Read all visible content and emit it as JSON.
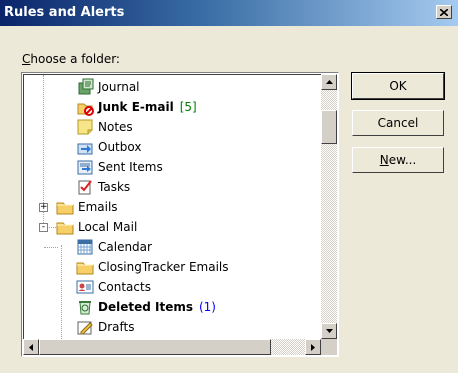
{
  "window": {
    "title": "Rules and Alerts"
  },
  "dialog": {
    "choose_label_accel": "C",
    "choose_label_rest": "hoose a folder:"
  },
  "tree": {
    "items": [
      {
        "label": "Journal",
        "icon": "journal-icon",
        "bold": false,
        "count": ""
      },
      {
        "label": "Junk E-mail",
        "icon": "junk-email-icon",
        "bold": true,
        "count": "[5]"
      },
      {
        "label": "Notes",
        "icon": "notes-icon",
        "bold": false,
        "count": ""
      },
      {
        "label": "Outbox",
        "icon": "outbox-icon",
        "bold": false,
        "count": ""
      },
      {
        "label": "Sent Items",
        "icon": "sent-items-icon",
        "bold": false,
        "count": ""
      },
      {
        "label": "Tasks",
        "icon": "tasks-icon",
        "bold": false,
        "count": ""
      },
      {
        "label": "Emails",
        "icon": "folder-icon",
        "bold": false,
        "count": "",
        "expander": "+"
      },
      {
        "label": "Local Mail",
        "icon": "folder-icon",
        "bold": false,
        "count": "",
        "expander": "-"
      },
      {
        "label": "Calendar",
        "icon": "calendar-icon",
        "bold": false,
        "count": ""
      },
      {
        "label": "ClosingTracker Emails",
        "icon": "folder-icon",
        "bold": false,
        "count": ""
      },
      {
        "label": "Contacts",
        "icon": "contacts-icon",
        "bold": false,
        "count": ""
      },
      {
        "label": "Deleted Items",
        "icon": "deleted-items-icon",
        "bold": true,
        "count": "(1)"
      },
      {
        "label": "Drafts",
        "icon": "drafts-icon",
        "bold": false,
        "count": ""
      }
    ]
  },
  "buttons": {
    "ok": "OK",
    "cancel": "Cancel",
    "new_accel": "N",
    "new_rest": "ew..."
  },
  "colors": {
    "title_start": "#0a246a",
    "title_end": "#a6caf0",
    "count_green": "#008000",
    "count_blue": "#0000ff",
    "dialog_bg": "#ece9d8"
  }
}
